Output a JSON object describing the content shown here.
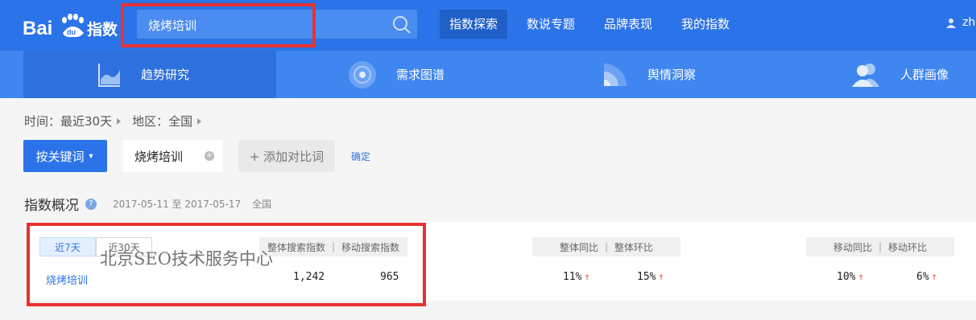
{
  "header": {
    "logo_text": "Bai指数",
    "search": {
      "value": "烧烤培训"
    },
    "nav": [
      {
        "label": "指数探索",
        "active": true
      },
      {
        "label": "数说专题",
        "active": false
      },
      {
        "label": "品牌表现",
        "active": false
      },
      {
        "label": "我的指数",
        "active": false
      }
    ],
    "user": "zh"
  },
  "subnav": {
    "tabs": [
      {
        "label": "趋势研究",
        "icon": "trend-chart-icon",
        "active": true
      },
      {
        "label": "需求图谱",
        "icon": "target-circle-icon",
        "active": false
      },
      {
        "label": "舆情洞察",
        "icon": "signal-icon",
        "active": false
      },
      {
        "label": "人群画像",
        "icon": "people-icon",
        "active": false
      }
    ]
  },
  "filters": {
    "time_label": "时间：最近30天",
    "region_label": "地区：全国"
  },
  "keyword_bar": {
    "mode_button": "按关键词",
    "term": "烧烤培训",
    "add_compare": "+ 添加对比词",
    "confirm": "确定"
  },
  "overview": {
    "title": "指数概况",
    "date_range": "2017-05-11 至 2017-05-17",
    "region": "全国",
    "period_tabs": [
      {
        "label": "近7天",
        "active": true
      },
      {
        "label": "近30天",
        "active": false
      }
    ],
    "headers": {
      "search_total": "整体搜索指数",
      "search_mobile": "移动搜索指数",
      "overall_yoy": "整体同比",
      "overall_mom": "整体环比",
      "mobile_yoy": "移动同比",
      "mobile_mom": "移动环比"
    },
    "row": {
      "keyword": "烧烤培训",
      "search_total": "1,242",
      "search_mobile": "965",
      "overall_yoy": "11%",
      "overall_mom": "15%",
      "mobile_yoy": "10%",
      "mobile_mom": "6%"
    },
    "trend_arrow": "↑"
  },
  "watermark": "北京SEO技术服务中心",
  "colors": {
    "header_blue": "#2b73e8",
    "subnav_blue": "#3f86f0",
    "highlight_red": "#e8322f",
    "up_arrow": "#e8553a"
  }
}
